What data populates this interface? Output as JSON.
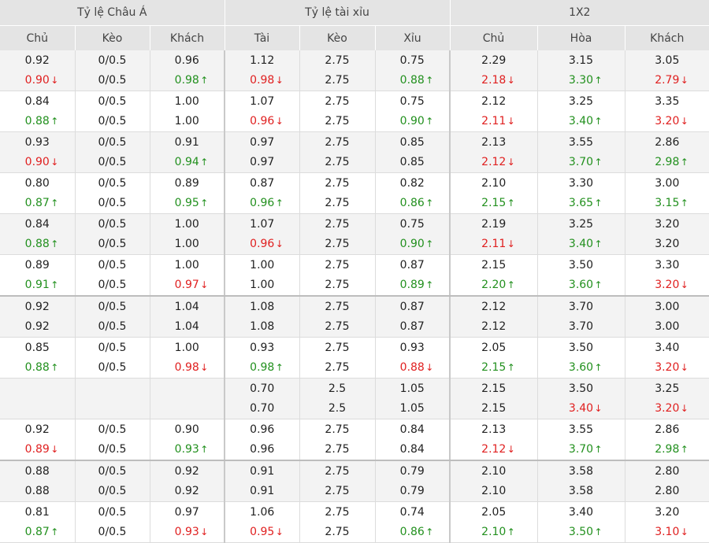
{
  "header": {
    "groups": [
      "Tỷ lệ Châu Á",
      "Tỷ lệ tài xỉu",
      "1X2"
    ],
    "columns": [
      "Chủ",
      "Kèo",
      "Khách",
      "Tài",
      "Kèo",
      "Xỉu",
      "Chủ",
      "Hòa",
      "Khách"
    ]
  },
  "arrows": {
    "up": "↑",
    "down": "↓"
  },
  "colors": {
    "up": "#22901e",
    "down": "#e02020",
    "header_bg": "#e4e4e4",
    "shade_bg": "#f3f3f3"
  },
  "rows": [
    {
      "top": [
        "0.92",
        "0/0.5",
        "0.96",
        "1.12",
        "2.75",
        "0.75",
        "2.29",
        "3.15",
        "3.05"
      ],
      "bottom": [
        "0.90",
        "0/0.5",
        "0.98",
        "0.98",
        "2.75",
        "0.88",
        "2.18",
        "3.30",
        "2.79"
      ],
      "dir": [
        "down",
        "",
        "up",
        "down",
        "",
        "up",
        "down",
        "up",
        "down"
      ]
    },
    {
      "top": [
        "0.84",
        "0/0.5",
        "1.00",
        "1.07",
        "2.75",
        "0.75",
        "2.12",
        "3.25",
        "3.35"
      ],
      "bottom": [
        "0.88",
        "0/0.5",
        "1.00",
        "0.96",
        "2.75",
        "0.90",
        "2.11",
        "3.40",
        "3.20"
      ],
      "dir": [
        "up",
        "",
        "",
        "down",
        "",
        "up",
        "down",
        "up",
        "down"
      ]
    },
    {
      "top": [
        "0.93",
        "0/0.5",
        "0.91",
        "0.97",
        "2.75",
        "0.85",
        "2.13",
        "3.55",
        "2.86"
      ],
      "bottom": [
        "0.90",
        "0/0.5",
        "0.94",
        "0.97",
        "2.75",
        "0.85",
        "2.12",
        "3.70",
        "2.98"
      ],
      "dir": [
        "down",
        "",
        "up",
        "",
        "",
        "",
        "down",
        "up",
        "up"
      ]
    },
    {
      "top": [
        "0.80",
        "0/0.5",
        "0.89",
        "0.87",
        "2.75",
        "0.82",
        "2.10",
        "3.30",
        "3.00"
      ],
      "bottom": [
        "0.87",
        "0/0.5",
        "0.95",
        "0.96",
        "2.75",
        "0.86",
        "2.15",
        "3.65",
        "3.15"
      ],
      "dir": [
        "up",
        "",
        "up",
        "up",
        "",
        "up",
        "up",
        "up",
        "up"
      ]
    },
    {
      "top": [
        "0.84",
        "0/0.5",
        "1.00",
        "1.07",
        "2.75",
        "0.75",
        "2.19",
        "3.25",
        "3.20"
      ],
      "bottom": [
        "0.88",
        "0/0.5",
        "1.00",
        "0.96",
        "2.75",
        "0.90",
        "2.11",
        "3.40",
        "3.20"
      ],
      "dir": [
        "up",
        "",
        "",
        "down",
        "",
        "up",
        "down",
        "up",
        ""
      ]
    },
    {
      "top": [
        "0.89",
        "0/0.5",
        "1.00",
        "1.00",
        "2.75",
        "0.87",
        "2.15",
        "3.50",
        "3.30"
      ],
      "bottom": [
        "0.91",
        "0/0.5",
        "0.97",
        "1.00",
        "2.75",
        "0.89",
        "2.20",
        "3.60",
        "3.20"
      ],
      "dir": [
        "up",
        "",
        "down",
        "",
        "",
        "up",
        "up",
        "up",
        "down"
      ]
    },
    {
      "top": [
        "0.92",
        "0/0.5",
        "1.04",
        "1.08",
        "2.75",
        "0.87",
        "2.12",
        "3.70",
        "3.00"
      ],
      "bottom": [
        "0.92",
        "0/0.5",
        "1.04",
        "1.08",
        "2.75",
        "0.87",
        "2.12",
        "3.70",
        "3.00"
      ],
      "dir": [
        "",
        "",
        "",
        "",
        "",
        "",
        "",
        "",
        ""
      ]
    },
    {
      "top": [
        "0.85",
        "0/0.5",
        "1.00",
        "0.93",
        "2.75",
        "0.93",
        "2.05",
        "3.50",
        "3.40"
      ],
      "bottom": [
        "0.88",
        "0/0.5",
        "0.98",
        "0.98",
        "2.75",
        "0.88",
        "2.15",
        "3.60",
        "3.20"
      ],
      "dir": [
        "up",
        "",
        "down",
        "up",
        "",
        "down",
        "up",
        "up",
        "down"
      ]
    },
    {
      "top": [
        "",
        "",
        "",
        "0.70",
        "2.5",
        "1.05",
        "2.15",
        "3.50",
        "3.25"
      ],
      "bottom": [
        "",
        "",
        "",
        "0.70",
        "2.5",
        "1.05",
        "2.15",
        "3.40",
        "3.20"
      ],
      "dir": [
        "",
        "",
        "",
        "",
        "",
        "",
        "",
        "down",
        "down"
      ]
    },
    {
      "top": [
        "0.92",
        "0/0.5",
        "0.90",
        "0.96",
        "2.75",
        "0.84",
        "2.13",
        "3.55",
        "2.86"
      ],
      "bottom": [
        "0.89",
        "0/0.5",
        "0.93",
        "0.96",
        "2.75",
        "0.84",
        "2.12",
        "3.70",
        "2.98"
      ],
      "dir": [
        "down",
        "",
        "up",
        "",
        "",
        "",
        "down",
        "up",
        "up"
      ]
    },
    {
      "top": [
        "0.88",
        "0/0.5",
        "0.92",
        "0.91",
        "2.75",
        "0.79",
        "2.10",
        "3.58",
        "2.80"
      ],
      "bottom": [
        "0.88",
        "0/0.5",
        "0.92",
        "0.91",
        "2.75",
        "0.79",
        "2.10",
        "3.58",
        "2.80"
      ],
      "dir": [
        "",
        "",
        "",
        "",
        "",
        "",
        "",
        "",
        ""
      ]
    },
    {
      "top": [
        "0.81",
        "0/0.5",
        "0.97",
        "1.06",
        "2.75",
        "0.74",
        "2.05",
        "3.40",
        "3.20"
      ],
      "bottom": [
        "0.87",
        "0/0.5",
        "0.93",
        "0.95",
        "2.75",
        "0.86",
        "2.10",
        "3.50",
        "3.10"
      ],
      "dir": [
        "up",
        "",
        "down",
        "down",
        "",
        "up",
        "up",
        "up",
        "down"
      ]
    }
  ]
}
